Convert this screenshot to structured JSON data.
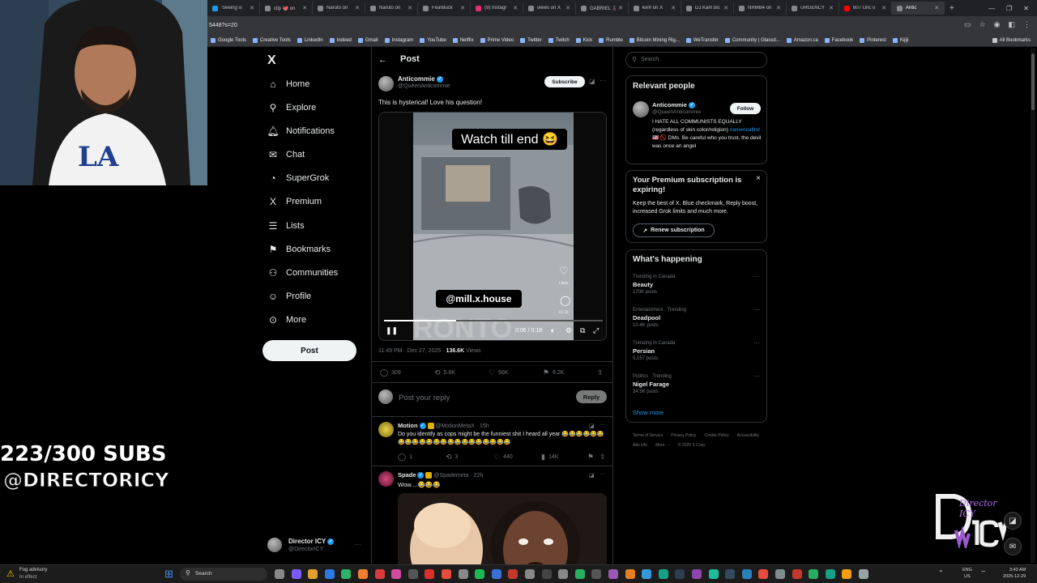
{
  "browser": {
    "tabs": [
      {
        "label": "'Seeing is",
        "color": "#1d9bf0"
      },
      {
        "label": "clip 🐙 on",
        "color": "#888"
      },
      {
        "label": "Naruto on",
        "color": "#888"
      },
      {
        "label": "Naruto on",
        "color": "#888"
      },
      {
        "label": "FearBuck",
        "color": "#888"
      },
      {
        "label": "(9) Instagr",
        "color": "#e1306c"
      },
      {
        "label": "views on X",
        "color": "#888"
      },
      {
        "label": "GABRIEL 🎩",
        "color": "#888"
      },
      {
        "label": "€e® on X",
        "color": "#888"
      },
      {
        "label": "DJ Kam Bo",
        "color": "#888"
      },
      {
        "label": "NRMB4 on",
        "color": "#888"
      },
      {
        "label": "URGENCY",
        "color": "#888"
      },
      {
        "label": "607 Unc o",
        "color": "#ff0000"
      },
      {
        "label": "Antic",
        "color": "#888",
        "active": true
      }
    ],
    "new_tab": "+",
    "url": "5448?s=20",
    "bookmarks": [
      "Google Tools",
      "Creative Tools",
      "LinkedIn",
      "Indeed",
      "Gmail",
      "Instagram",
      "YouTube",
      "Netflix",
      "Prime Video",
      "Twitter",
      "Twitch",
      "Kick",
      "Rumble",
      "Bitcoin Mining Rig...",
      "WeTransfer",
      "Community | Glassd...",
      "Amazon.ca",
      "Facebook",
      "Pinterest",
      "Kijiji"
    ],
    "all_bookmarks": "All Bookmarks"
  },
  "nav": {
    "logo": "X",
    "items": [
      {
        "label": "Home",
        "icon": "home-icon",
        "glyph": "⌂"
      },
      {
        "label": "Explore",
        "icon": "search-icon",
        "glyph": "⚲"
      },
      {
        "label": "Notifications",
        "icon": "bell-icon",
        "glyph": "🔔︎"
      },
      {
        "label": "Chat",
        "icon": "mail-icon",
        "glyph": "✉"
      },
      {
        "label": "SuperGrok",
        "icon": "grok-icon",
        "glyph": "◔"
      },
      {
        "label": "Premium",
        "icon": "x-icon",
        "glyph": "X"
      },
      {
        "label": "Lists",
        "icon": "list-icon",
        "glyph": "☰"
      },
      {
        "label": "Bookmarks",
        "icon": "bookmark-icon",
        "glyph": "⚑"
      },
      {
        "label": "Communities",
        "icon": "communities-icon",
        "glyph": "⚇"
      },
      {
        "label": "Profile",
        "icon": "profile-icon",
        "glyph": "☺"
      },
      {
        "label": "More",
        "icon": "more-icon",
        "glyph": "⊙"
      }
    ],
    "post_button": "Post",
    "account": {
      "name": "Director ICY",
      "handle": "@DirectorICY",
      "more": "···"
    }
  },
  "post": {
    "header": "Post",
    "author": {
      "name": "Anticommie",
      "handle": "@QueenAnticommie"
    },
    "subscribe": "Subscribe",
    "text": "This is hysterical! Love his question!",
    "video": {
      "caption_top": "Watch till end 😆",
      "caption_mid": "@mill.x.house",
      "watermark": "RONTO",
      "time": "0:06 / 0:18",
      "likes_label": "Likes",
      "comments_count": "10.1K",
      "progress": 0.33
    },
    "meta": {
      "time": "11:49 PM · Dec 27, 2025 ·",
      "views": "136.6K",
      "views_label": "Views"
    },
    "actions": {
      "replies": "309",
      "reposts": "5.8K",
      "likes": "56K",
      "bookmarks": "6.2K"
    },
    "reply_placeholder": "Post your reply",
    "reply_button": "Reply"
  },
  "replies": [
    {
      "name": "Motion",
      "handle": "@MotionMetaX · 15h",
      "text": "Do you identify as cops might be the funniest shit I heard all year 😂😂😂😂😂😂😂😂😂😂😂😂😂😂😂😂😂😂😂😂😂😂",
      "replies": "1",
      "reposts": "3",
      "likes": "440",
      "views": "14K"
    },
    {
      "name": "Spade",
      "handle": "@Spademeta · 22h",
      "text": "Wow....😂😂😂"
    }
  ],
  "sidebar": {
    "search_placeholder": "Search",
    "relevant_title": "Relevant people",
    "person": {
      "name": "Anticommie",
      "handle": "@QueenAnticommie",
      "follow": "Follow",
      "bio_1": "I HATE ALL COMMUNISTS EQUALLY (regardless of skin color/religion)",
      "hashtag": "#americafirst",
      "bio_2": "🇺🇸 🚫 DMs. Be careful who you trust, the devil was once an angel"
    },
    "premium": {
      "title": "Your Premium subscription is expiring!",
      "body": "Keep the best of X. Blue checkmark, Reply boost, increased Grok limits and much more.",
      "button": "Renew subscription",
      "close": "×"
    },
    "happening_title": "What's happening",
    "trends": [
      {
        "category": "Trending in Canada",
        "name": "Beauty",
        "count": "170K posts"
      },
      {
        "category": "Entertainment · Trending",
        "name": "Deadpool",
        "count": "10.4K posts"
      },
      {
        "category": "Trending in Canada",
        "name": "Persian",
        "count": "5,157 posts"
      },
      {
        "category": "Politics · Trending",
        "name": "Nigel Farage",
        "count": "34.5K posts"
      }
    ],
    "show_more": "Show more",
    "footer": [
      "Terms of Service",
      "Privacy Policy",
      "Cookie Policy",
      "Accessibility",
      "Ads info",
      "More ···",
      "© 2025 X Corp."
    ]
  },
  "overlay": {
    "subs": "223/300 SUBS",
    "handle": "@DIRECTORICY",
    "logo_text": "Director ICY"
  },
  "taskbar": {
    "weather_1": "Fog advisory",
    "weather_2": "In effect",
    "search": "Search",
    "lang_1": "ENG",
    "lang_2": "US",
    "time": "3:43 AM",
    "date": "2025-12-29"
  }
}
